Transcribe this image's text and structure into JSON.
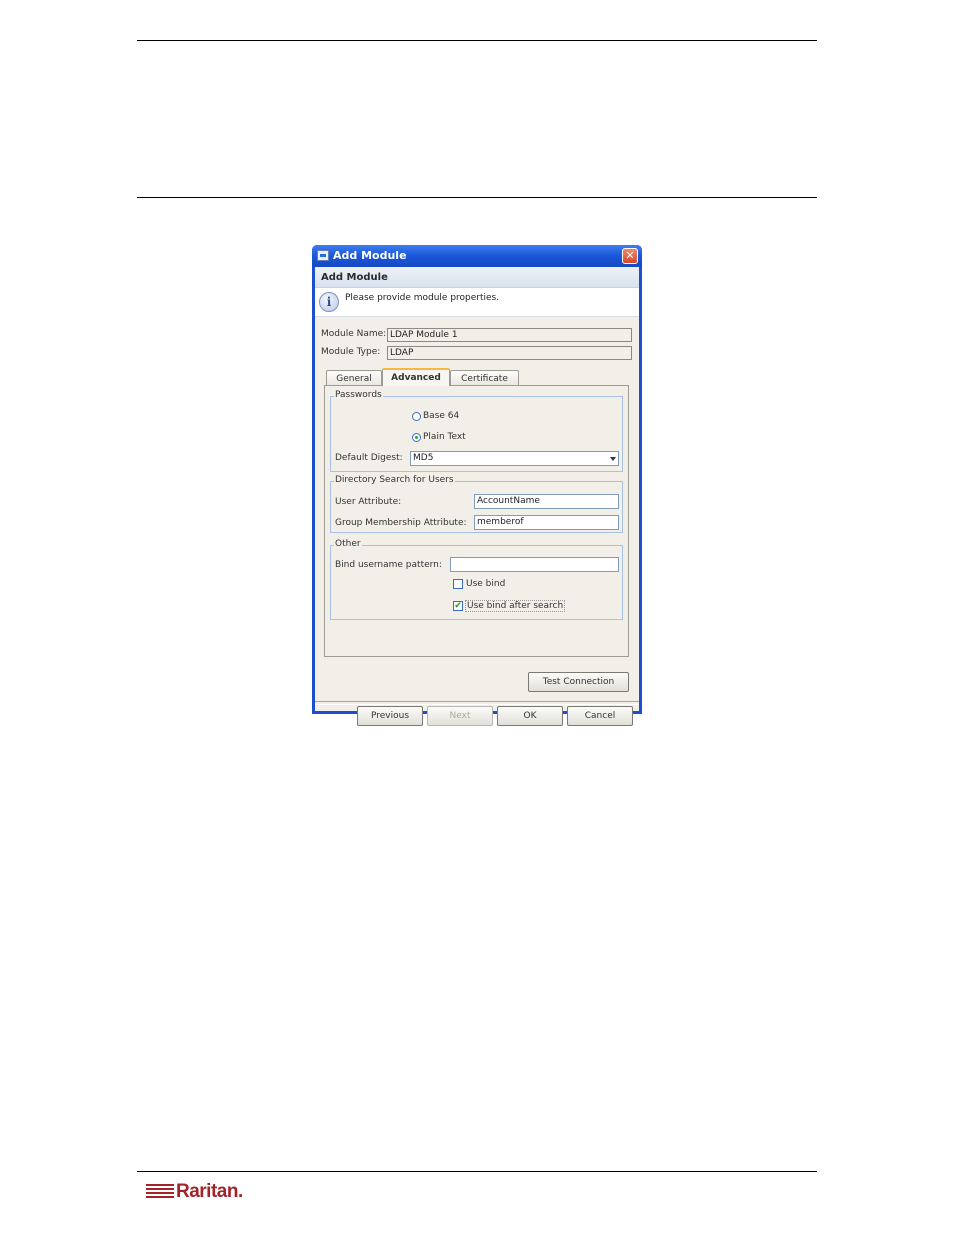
{
  "dialog": {
    "window_title": "Add Module",
    "header": "Add Module",
    "info_message": "Please provide module properties.",
    "module_name_label": "Module Name:",
    "module_name_value": "LDAP Module 1",
    "module_type_label": "Module Type:",
    "module_type_value": "LDAP",
    "tabs": [
      {
        "label": "General",
        "active": false
      },
      {
        "label": "Advanced",
        "active": true
      },
      {
        "label": "Certificate",
        "active": false
      }
    ],
    "passwords": {
      "legend": "Passwords",
      "options": [
        {
          "label": "Base 64",
          "selected": false
        },
        {
          "label": "Plain Text",
          "selected": true
        }
      ],
      "default_digest_label": "Default Digest:",
      "default_digest_value": "MD5"
    },
    "directory_search": {
      "legend": "Directory Search for Users",
      "user_attribute_label": "User Attribute:",
      "user_attribute_value": "AccountName",
      "group_membership_label": "Group Membership Attribute:",
      "group_membership_value": "memberof"
    },
    "other": {
      "legend": "Other",
      "bind_pattern_label": "Bind username pattern:",
      "bind_pattern_value": "",
      "use_bind_label": "Use bind",
      "use_bind_checked": false,
      "use_bind_after_search_label": "Use bind after search",
      "use_bind_after_search_checked": true
    },
    "buttons": {
      "test_connection": "Test Connection",
      "previous": "Previous",
      "next": "Next",
      "ok": "OK",
      "cancel": "Cancel"
    },
    "close_glyph": "✕",
    "info_glyph": "i",
    "check_glyph": "✔"
  },
  "footer": {
    "logo_text": "Raritan.",
    "brand_color": "#a3232b"
  }
}
